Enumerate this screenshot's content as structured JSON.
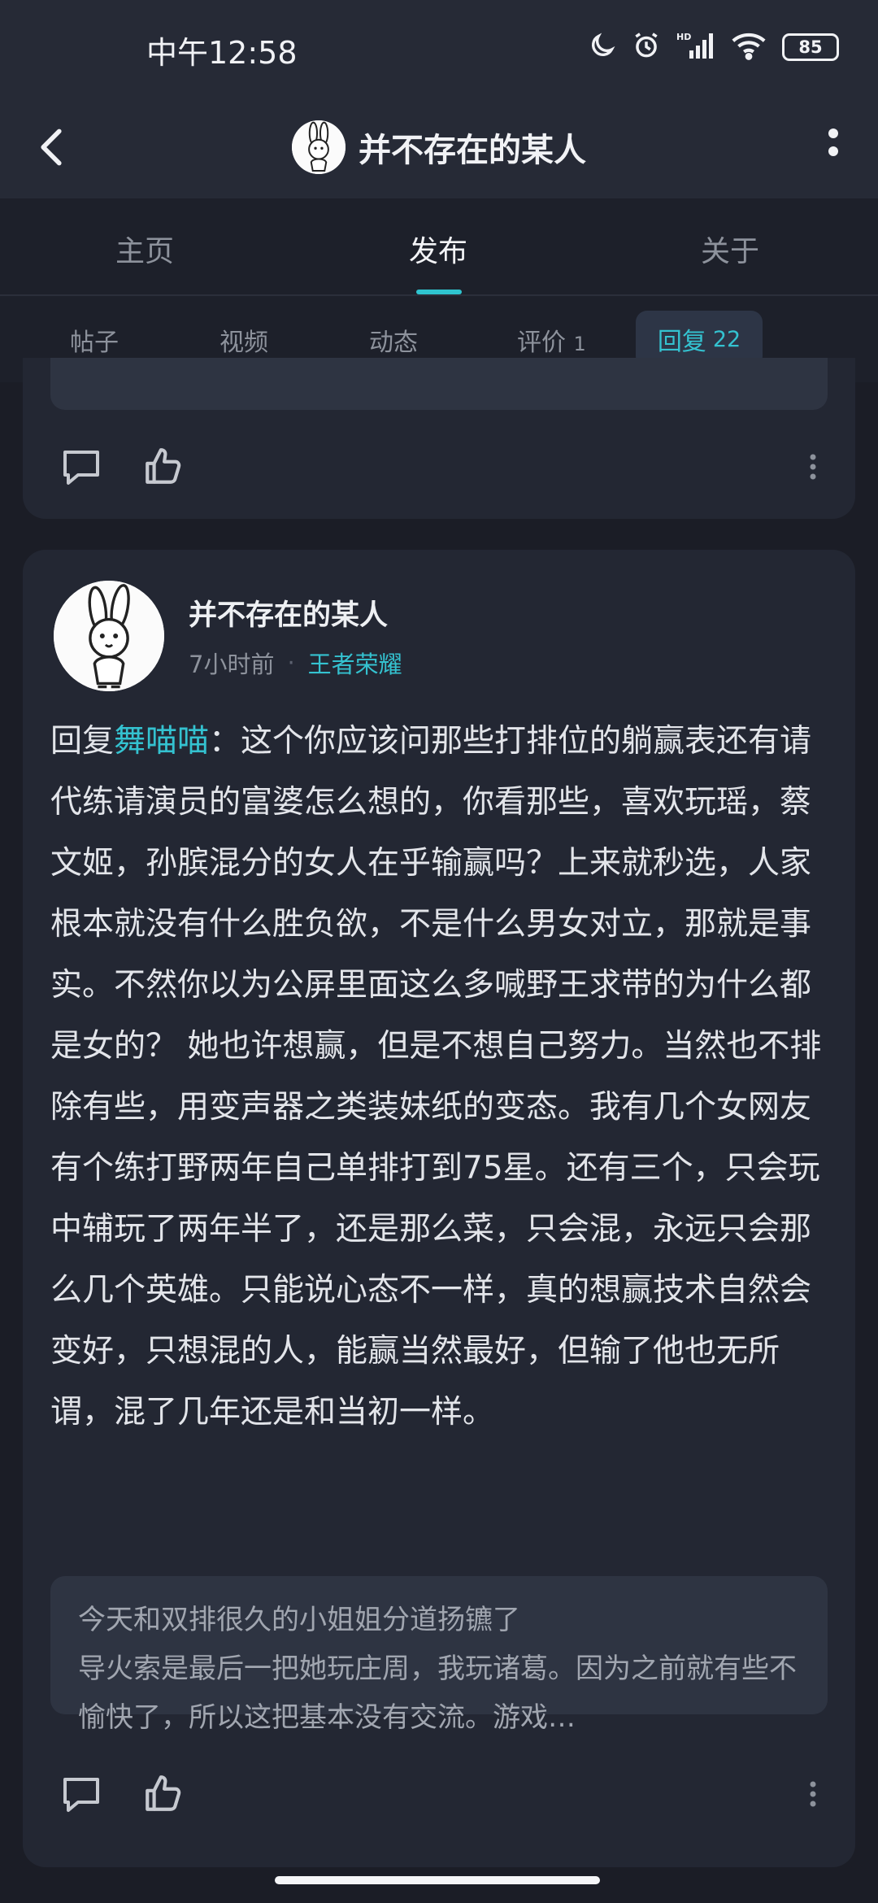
{
  "status_bar": {
    "time": "中午12:58",
    "battery": "85",
    "icons": [
      "moon-icon",
      "alarm-icon",
      "hd-signal-icon",
      "wifi-icon",
      "battery-icon"
    ]
  },
  "header": {
    "title": "并不存在的某人",
    "icons": [
      "back-icon",
      "avatar",
      "more-vertical-icon"
    ]
  },
  "tabs": [
    {
      "label": "主页"
    },
    {
      "label": "发布"
    },
    {
      "label": "关于"
    }
  ],
  "subtabs": [
    {
      "label": "帖子"
    },
    {
      "label": "视频"
    },
    {
      "label": "动态"
    },
    {
      "label": "评价",
      "count": "1"
    },
    {
      "label": "回复",
      "count": "22"
    }
  ],
  "post": {
    "author": "并不存在的某人",
    "time": "7小时前",
    "separator": "·",
    "game": "王者荣耀",
    "reply_prefix": "回复",
    "reply_to": "舞喵喵",
    "body": "：这个你应该问那些打排位的躺赢表还有请代练请演员的富婆怎么想的，你看那些，喜欢玩瑶，蔡文姬，孙膑混分的女人在乎输赢吗？上来就秒选，人家根本就没有什么胜负欲，不是什么男女对立，那就是事实。不然你以为公屏里面这么多喊野王求带的为什么都是女的？ 她也许想赢，但是不想自己努力。当然也不排除有些，用变声器之类装妹纸的变态。我有几个女网友有个练打野两年自己单排打到75星。还有三个，只会玩中辅玩了两年半了，还是那么菜，只会混，永远只会那么几个英雄。只能说心态不一样，真的想赢技术自然会变好，只想混的人，能赢当然最好，但输了他也无所谓，混了几年还是和当初一样。",
    "quote_title": "今天和双排很久的小姐姐分道扬镳了",
    "quote_text": "导火索是最后一把她玩庄周，我玩诸葛。因为之前就有些不愉快了，所以这把基本没有交流。游戏…"
  },
  "colors": {
    "background": "#1b1d26",
    "card": "#232733",
    "accent": "#34c2d0",
    "text": "#e3e5ea",
    "muted": "#8d929c"
  }
}
